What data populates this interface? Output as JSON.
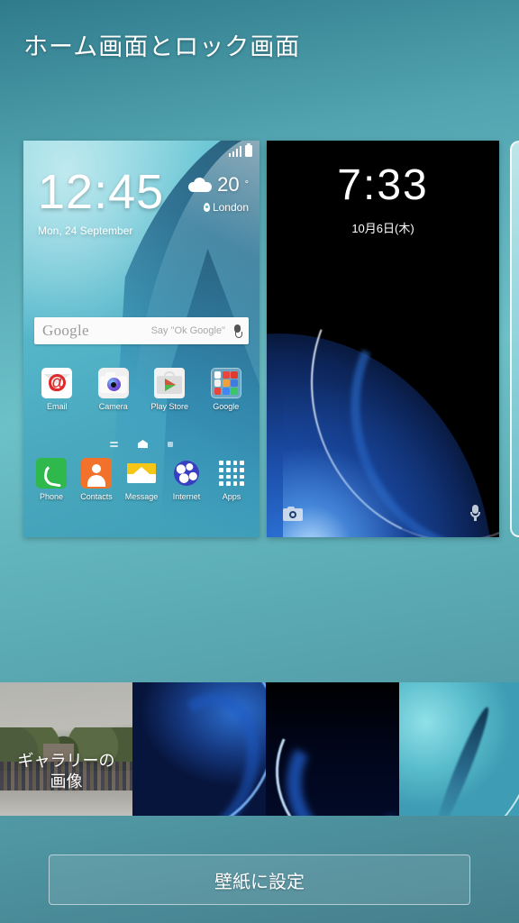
{
  "header": {
    "title": "ホーム画面とロック画面"
  },
  "home_preview": {
    "status": {
      "signal_icon": "signal-bars-icon",
      "battery_icon": "battery-icon"
    },
    "clock": {
      "time": "12:45",
      "date": "Mon, 24 September"
    },
    "weather": {
      "icon": "cloud-icon",
      "temperature": "20",
      "degree": "°",
      "location_icon": "location-pin-icon",
      "location": "London"
    },
    "search": {
      "logo": "Google",
      "hint": "Say \"Ok Google\"",
      "mic_icon": "microphone-icon"
    },
    "apps": [
      {
        "label": "Email",
        "icon": "email-icon"
      },
      {
        "label": "Camera",
        "icon": "camera-icon"
      },
      {
        "label": "Play Store",
        "icon": "play-store-icon"
      },
      {
        "label": "Google",
        "icon": "google-folder-icon"
      }
    ],
    "page_indicators": [
      {
        "icon": "list-page-icon",
        "active": false
      },
      {
        "icon": "home-page-icon",
        "active": true
      },
      {
        "icon": "dot-page-icon",
        "active": false
      }
    ],
    "dock": [
      {
        "label": "Phone",
        "icon": "phone-icon"
      },
      {
        "label": "Contacts",
        "icon": "contacts-icon"
      },
      {
        "label": "Message",
        "icon": "message-icon"
      },
      {
        "label": "Internet",
        "icon": "internet-icon"
      },
      {
        "label": "Apps",
        "icon": "apps-grid-icon"
      }
    ]
  },
  "lock_preview": {
    "time": "7:33",
    "date": "10月6日(木)",
    "camera_icon": "camera-shortcut-icon",
    "mic_icon": "microphone-shortcut-icon"
  },
  "thumbnails": [
    {
      "name": "gallery",
      "label": "ギャラリーの\n画像"
    },
    {
      "name": "blue-wave",
      "label": ""
    },
    {
      "name": "black-blue-wave",
      "label": ""
    },
    {
      "name": "teal-wave",
      "label": ""
    }
  ],
  "footer": {
    "set_wallpaper_label": "壁紙に設定"
  },
  "colors": {
    "background_top": "#2f7b8c",
    "background_bottom": "#457f8c",
    "accent_white": "#ffffff",
    "home_wallpaper": "#58b9cc",
    "lock_wallpaper": "#000000"
  }
}
